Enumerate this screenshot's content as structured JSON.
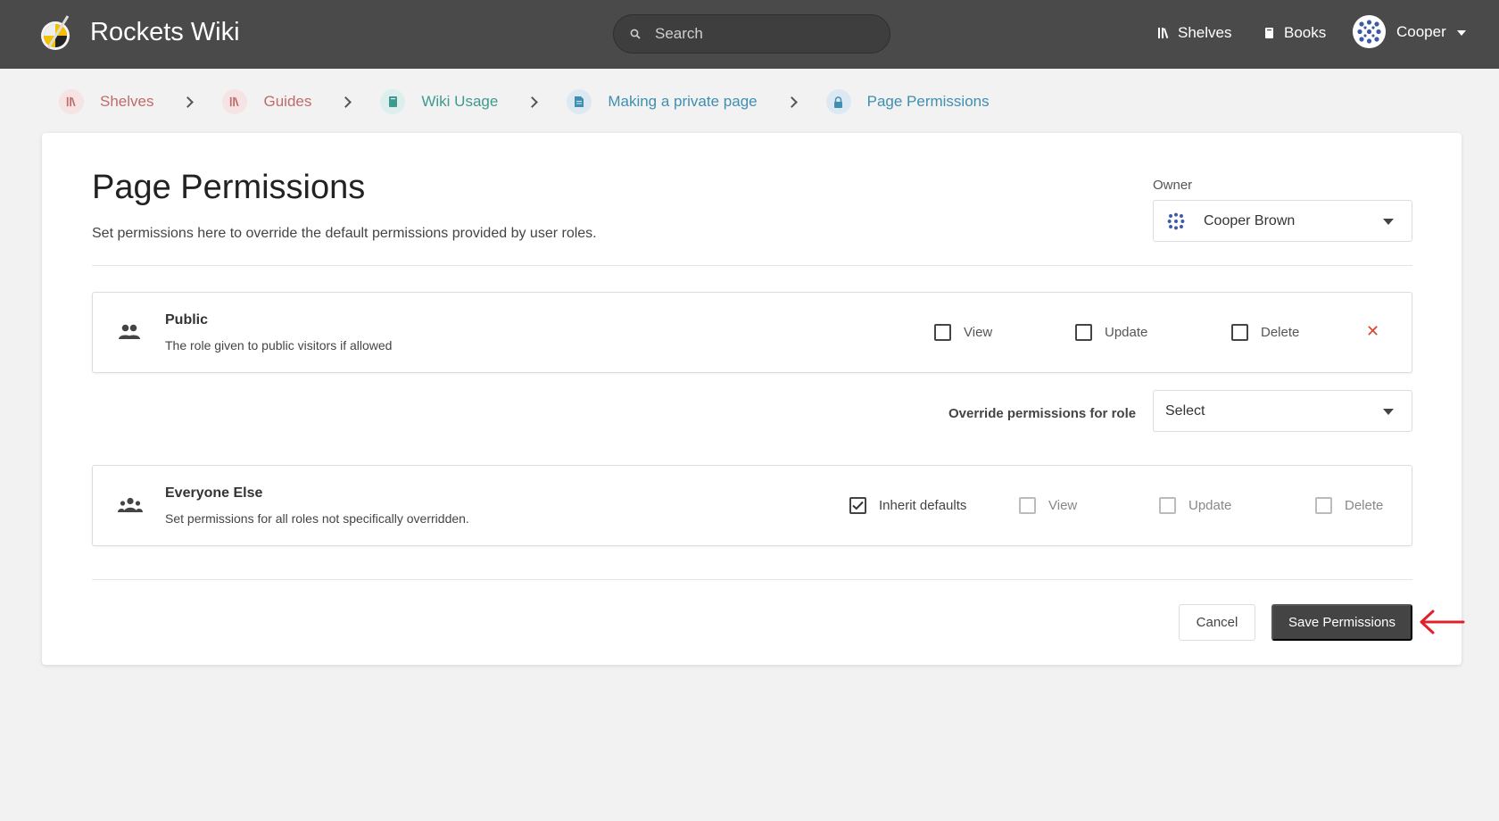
{
  "header": {
    "app_title": "Rockets Wiki",
    "search_placeholder": "Search",
    "nav": {
      "shelves": "Shelves",
      "books": "Books"
    },
    "user_name": "Cooper"
  },
  "breadcrumbs": [
    {
      "label": "Shelves",
      "color": "#c06a6a",
      "bg": "#f6e3e3",
      "icon": "shelves-icon"
    },
    {
      "label": "Guides",
      "color": "#c06a6a",
      "bg": "#f6e3e3",
      "icon": "shelves-icon"
    },
    {
      "label": "Wiki Usage",
      "color": "#3e9a8f",
      "bg": "#dcefed",
      "icon": "book-icon"
    },
    {
      "label": "Making a private page",
      "color": "#3f8fb0",
      "bg": "#dde9f2",
      "icon": "page-icon"
    },
    {
      "label": "Page Permissions",
      "color": "#3f8fb0",
      "bg": "#dde9f2",
      "icon": "lock-icon"
    }
  ],
  "page": {
    "title": "Page Permissions",
    "description": "Set permissions here to override the default permissions provided by user roles.",
    "owner_label": "Owner",
    "owner_value": "Cooper Brown"
  },
  "roles": {
    "public": {
      "name": "Public",
      "description": "The role given to public visitors if allowed",
      "view": "View",
      "update": "Update",
      "delete": "Delete",
      "remove_symbol": "✕"
    },
    "override_label": "Override permissions for role",
    "override_select": "Select",
    "everyone": {
      "name": "Everyone Else",
      "description": "Set permissions for all roles not specifically overridden.",
      "inherit": "Inherit defaults",
      "inherit_checked": true,
      "view": "View",
      "update": "Update",
      "delete": "Delete"
    }
  },
  "actions": {
    "cancel": "Cancel",
    "save": "Save Permissions"
  },
  "colors": {
    "header_bg": "#4a4a4a",
    "save_bg": "#444444",
    "danger": "#dd4433",
    "annotation_arrow": "#e0202a"
  }
}
